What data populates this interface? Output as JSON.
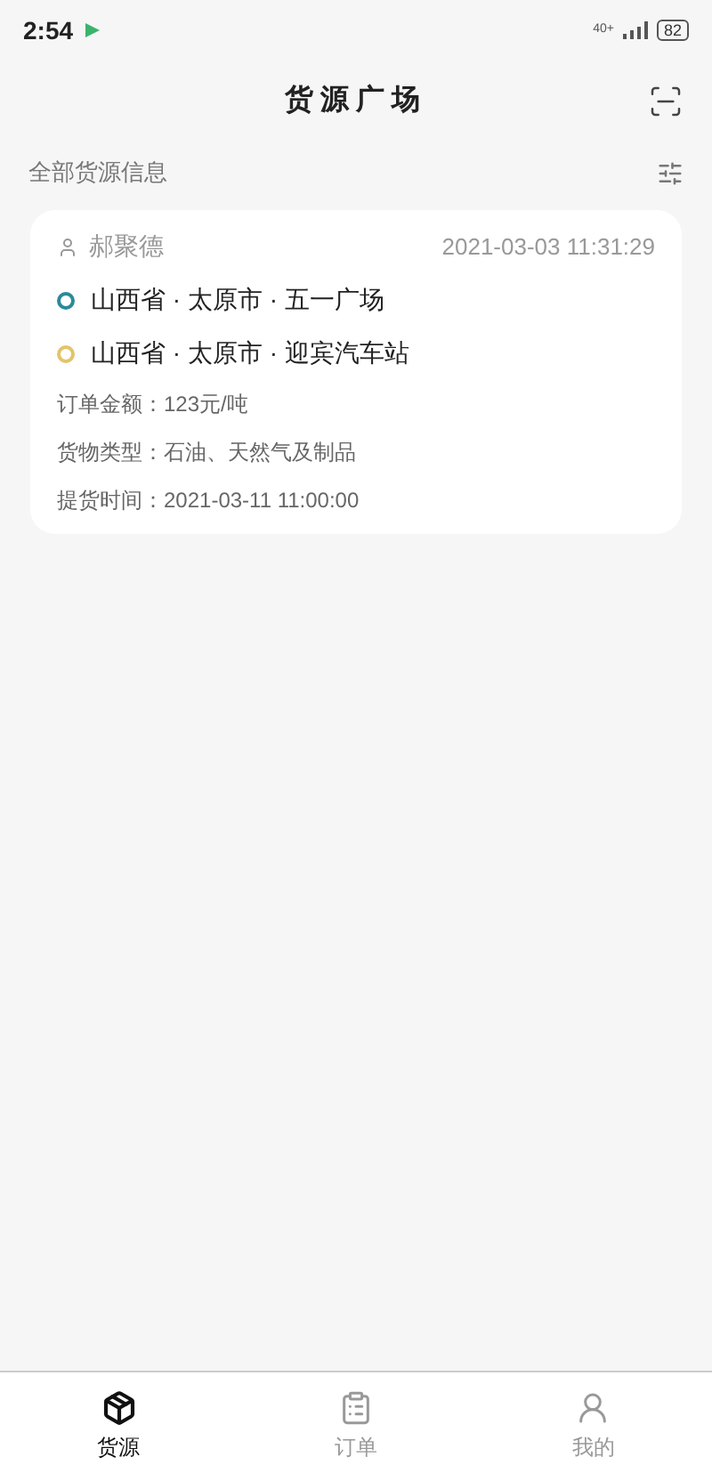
{
  "status_bar": {
    "time": "2:54",
    "network": "40+",
    "battery": "82"
  },
  "header": {
    "title": "货源广场"
  },
  "filter_bar": {
    "label": "全部货源信息"
  },
  "cargo_cards": [
    {
      "shipper": "郝聚德",
      "posted_at": "2021-03-03 11:31:29",
      "stops": [
        {
          "text": "山西省 · 太原市 · 五一广场",
          "color": "#2a8a9a"
        },
        {
          "text": "山西省 · 太原市 · 迎宾汽车站",
          "color": "#e3c46a"
        }
      ],
      "details": [
        "订单金额：123元/吨",
        "货物类型：石油、天然气及制品",
        "提货时间：2021-03-11 11:00:00"
      ]
    }
  ],
  "tabs": [
    {
      "label": "货源",
      "selected": true,
      "kind": "cargo"
    },
    {
      "label": "订单",
      "selected": false,
      "kind": "orders"
    },
    {
      "label": "我的",
      "selected": false,
      "kind": "profile"
    }
  ]
}
